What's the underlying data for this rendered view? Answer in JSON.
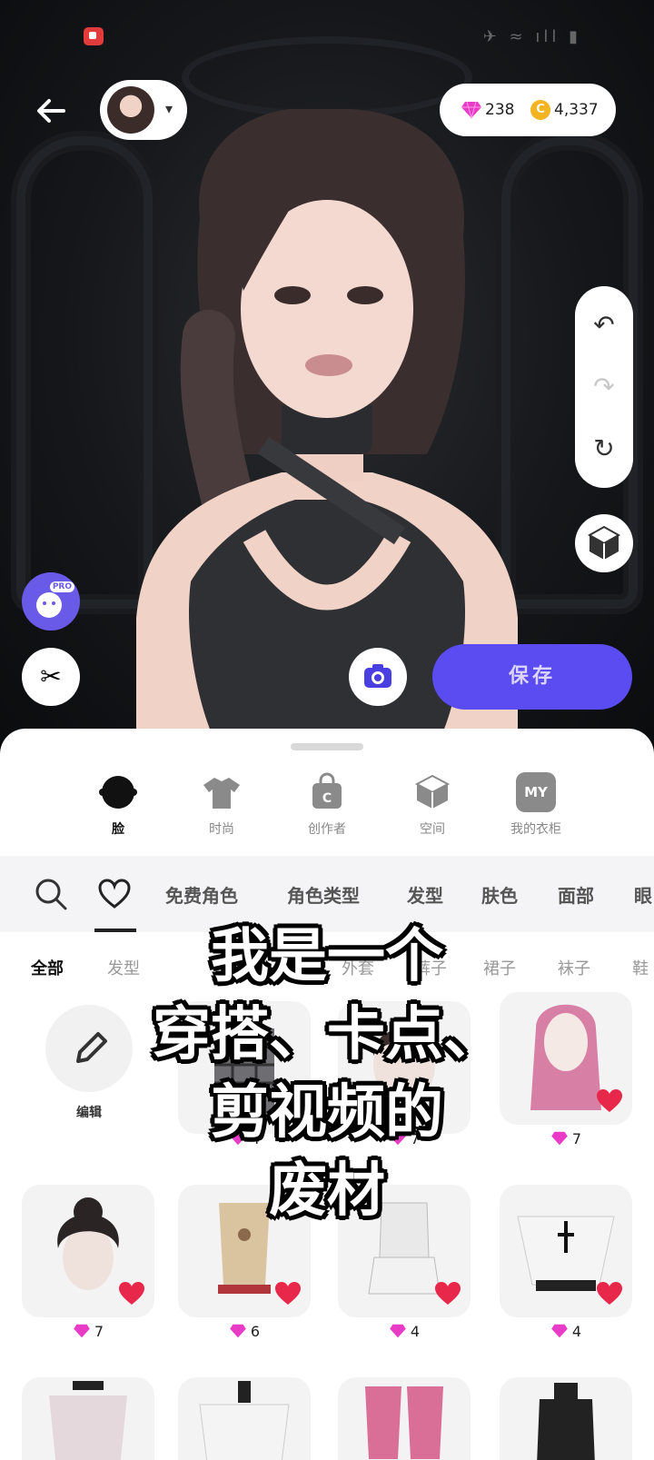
{
  "status_bar": {
    "icons": "✈ ≈ ıll ▮"
  },
  "header": {
    "back_icon": "arrow-left-icon",
    "character_caret": "▾",
    "gems": "238",
    "coin_symbol": "C",
    "coins": "4,337"
  },
  "history": {
    "undo": "↶",
    "redo": "↷",
    "reset": "↻"
  },
  "tools": {
    "pro_tag": "PRO",
    "magic": "✂"
  },
  "save_label": "保存",
  "categories": [
    {
      "label": "脸",
      "icon": "face-icon",
      "active": true
    },
    {
      "label": "时尚",
      "icon": "tshirt-icon",
      "active": false
    },
    {
      "label": "创作者",
      "icon": "creator-bag-icon",
      "active": false
    },
    {
      "label": "空间",
      "icon": "cube-icon",
      "active": false
    },
    {
      "label": "我的衣柜",
      "icon": "my-wardrobe-icon",
      "active": false,
      "badge": "MY"
    }
  ],
  "filter_chips": [
    "免费角色",
    "角色类型",
    "发型",
    "肤色",
    "面部",
    "眼"
  ],
  "sub_categories": [
    "全部",
    "发型",
    "外套",
    "裤子",
    "裙子",
    "袜子",
    "鞋"
  ],
  "edit_label": "编辑",
  "items": [
    {
      "price": "4"
    },
    {
      "price": "7"
    },
    {
      "price": "7"
    },
    {
      "price": "7"
    },
    {
      "price": "6"
    },
    {
      "price": "4"
    },
    {
      "price": "4"
    }
  ],
  "overlay_caption": [
    "我是一个",
    "穿搭、卡点、",
    "剪视频的",
    "废材"
  ]
}
